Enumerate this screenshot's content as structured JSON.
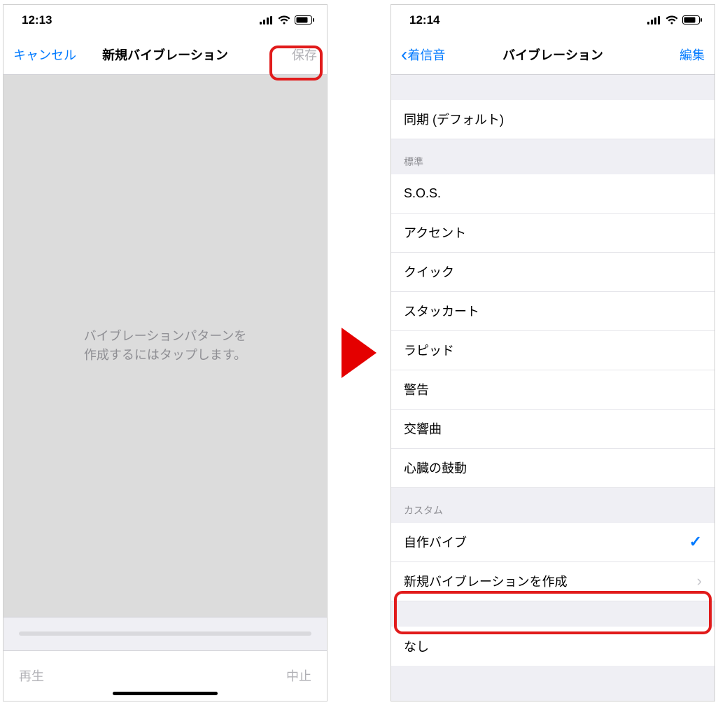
{
  "left": {
    "status_time": "12:13",
    "nav_cancel": "キャンセル",
    "nav_title": "新規バイブレーション",
    "nav_save": "保存",
    "body_hint_line1": "バイブレーションパターンを",
    "body_hint_line2": "作成するにはタップします。",
    "play": "再生",
    "stop": "中止"
  },
  "right": {
    "status_time": "12:14",
    "nav_back": "着信音",
    "nav_title": "バイブレーション",
    "nav_edit": "編集",
    "default_row": "同期 (デフォルト)",
    "section_standard": "標準",
    "standard_items": {
      "0": "S.O.S.",
      "1": "アクセント",
      "2": "クイック",
      "3": "スタッカート",
      "4": "ラピッド",
      "5": "警告",
      "6": "交響曲",
      "7": "心臓の鼓動"
    },
    "section_custom": "カスタム",
    "custom_selected": "自作バイブ",
    "create_new": "新規バイブレーションを作成",
    "none": "なし"
  }
}
